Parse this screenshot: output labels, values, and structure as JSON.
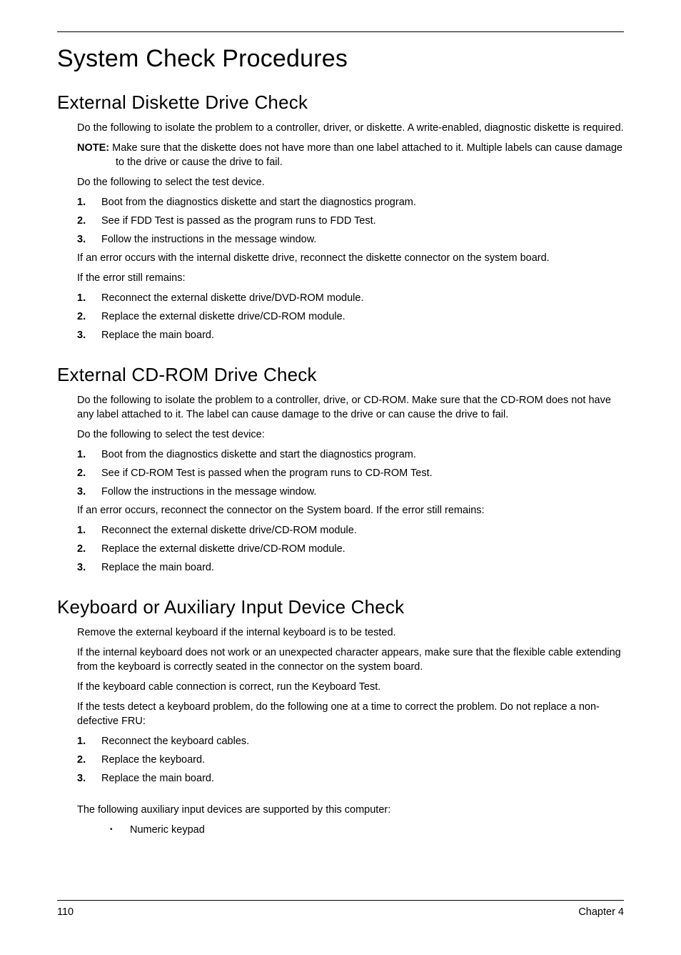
{
  "title": "System Check Procedures",
  "sections": {
    "diskette": {
      "heading": "External Diskette Drive Check",
      "intro": "Do the following to isolate the problem to a controller, driver, or diskette. A write-enabled, diagnostic diskette is required.",
      "note_label": "NOTE:",
      "note_text": "Make sure that the diskette does not have more than one label attached to it. Multiple labels can cause damage to the drive or cause the drive to fail.",
      "select_intro": "Do the following to select the test device.",
      "steps1": [
        "Boot from the diagnostics diskette and start the diagnostics program.",
        "See if FDD Test is passed as the program runs to FDD Test.",
        "Follow the instructions in the message window."
      ],
      "post1": "If an error occurs with the internal diskette drive, reconnect the diskette connector on the system board.",
      "post2": "If the error still remains:",
      "steps2": [
        "Reconnect the external diskette drive/DVD-ROM module.",
        "Replace the external diskette drive/CD-ROM module.",
        "Replace the main board."
      ]
    },
    "cdrom": {
      "heading": "External CD-ROM Drive Check",
      "intro": "Do the following to isolate the problem to a controller, drive, or CD-ROM. Make sure that the CD-ROM does not have any label attached to it. The label can cause damage to the drive or can cause the drive to fail.",
      "select_intro": "Do the following to select the test device:",
      "steps1": [
        "Boot from the diagnostics diskette and start the diagnostics program.",
        "See if CD-ROM Test is passed when the program runs to CD-ROM Test.",
        "Follow the instructions in the message window."
      ],
      "post1": "If an error occurs, reconnect the connector on the System board. If the error still remains:",
      "steps2": [
        "Reconnect the external diskette drive/CD-ROM module.",
        "Replace the external diskette drive/CD-ROM module.",
        "Replace the main board."
      ]
    },
    "keyboard": {
      "heading": "Keyboard or Auxiliary Input Device Check",
      "p1": "Remove the external keyboard if the internal keyboard is to be tested.",
      "p2": "If the internal keyboard does not work or an unexpected character appears, make sure that the flexible cable extending from the keyboard is correctly seated in the connector on the system board.",
      "p3": "If the keyboard cable connection is correct, run the Keyboard Test.",
      "p4": "If the tests detect a keyboard problem, do the following one at a time to correct the problem. Do not replace a non-defective FRU:",
      "steps": [
        "Reconnect the keyboard cables.",
        "Replace the keyboard.",
        "Replace the main board."
      ],
      "aux_intro": "The following auxiliary input devices are supported by this computer:",
      "aux_items": [
        "Numeric keypad"
      ]
    }
  },
  "footer": {
    "left": "110",
    "right": "Chapter 4"
  }
}
